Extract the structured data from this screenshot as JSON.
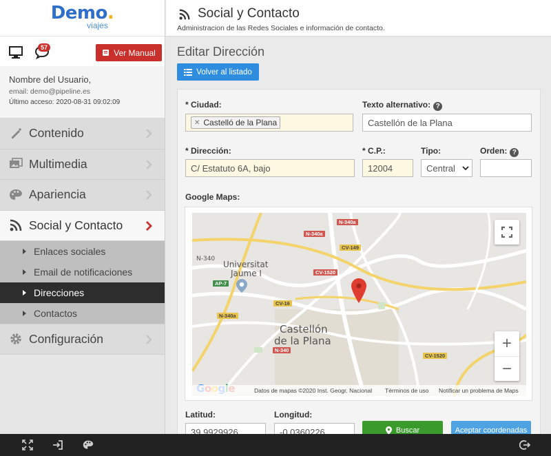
{
  "logo": {
    "main": "Demo",
    "dot": ".",
    "sub": "viajes"
  },
  "toolbar": {
    "notifications": "57",
    "manual_label": "Ver Manual"
  },
  "user": {
    "name": "Nombre del Usuario,",
    "email": "email: demo@pipeline.es",
    "last_access": "Último acceso: 2020-08-31 09:02:09"
  },
  "nav": [
    {
      "label": "Contenido",
      "icon": "pencil-icon"
    },
    {
      "label": "Multimedia",
      "icon": "images-icon"
    },
    {
      "label": "Apariencia",
      "icon": "palette-icon"
    },
    {
      "label": "Social y Contacto",
      "icon": "rss-icon"
    },
    {
      "label": "Configuración",
      "icon": "gear-icon"
    }
  ],
  "subnav": [
    {
      "label": "Enlaces sociales"
    },
    {
      "label": "Email de notificaciones"
    },
    {
      "label": "Direcciones"
    },
    {
      "label": "Contactos"
    }
  ],
  "header": {
    "title": "Social y Contacto",
    "description": "Administracion de las Redes Sociales e información de contacto."
  },
  "main": {
    "section_title": "Editar Dirección",
    "back_label": "Volver al listado"
  },
  "form": {
    "ciudad_label": "* Ciudad:",
    "ciudad_tag": "Castelló de la Plana",
    "alt_label": "Texto alternativo:",
    "alt_value": "Castellón de la Plana",
    "direccion_label": "* Dirección:",
    "direccion_value": "C/ Estatuto 6A, bajo",
    "cp_label": "* C.P.:",
    "cp_value": "12004",
    "tipo_label": "Tipo:",
    "tipo_value": "Central",
    "orden_label": "Orden:",
    "orden_value": "",
    "maps_label": "Google Maps:",
    "latitud_label": "Latitud:",
    "latitud_value": "39.9929926",
    "longitud_label": "Longitud:",
    "longitud_value": "-0.0360226",
    "buscar_label": "Buscar",
    "aceptar_label": "Aceptar coordenadas"
  },
  "map": {
    "city_line1": "Castellón",
    "city_line2": "de la Plana",
    "university_line1": "Universitat",
    "university_line2": "Jaume I",
    "roads": [
      "N-340a",
      "N-340a",
      "CV-149",
      "N-340",
      "AP-7",
      "CV-1520",
      "CV-16",
      "N-340a",
      "CV-1520",
      "N-340"
    ],
    "footer_data": "Datos de mapas ©2020 Inst. Geogr. Nacional",
    "footer_terms": "Términos de uso",
    "footer_report": "Notificar un problema de Maps",
    "google": "Google"
  }
}
